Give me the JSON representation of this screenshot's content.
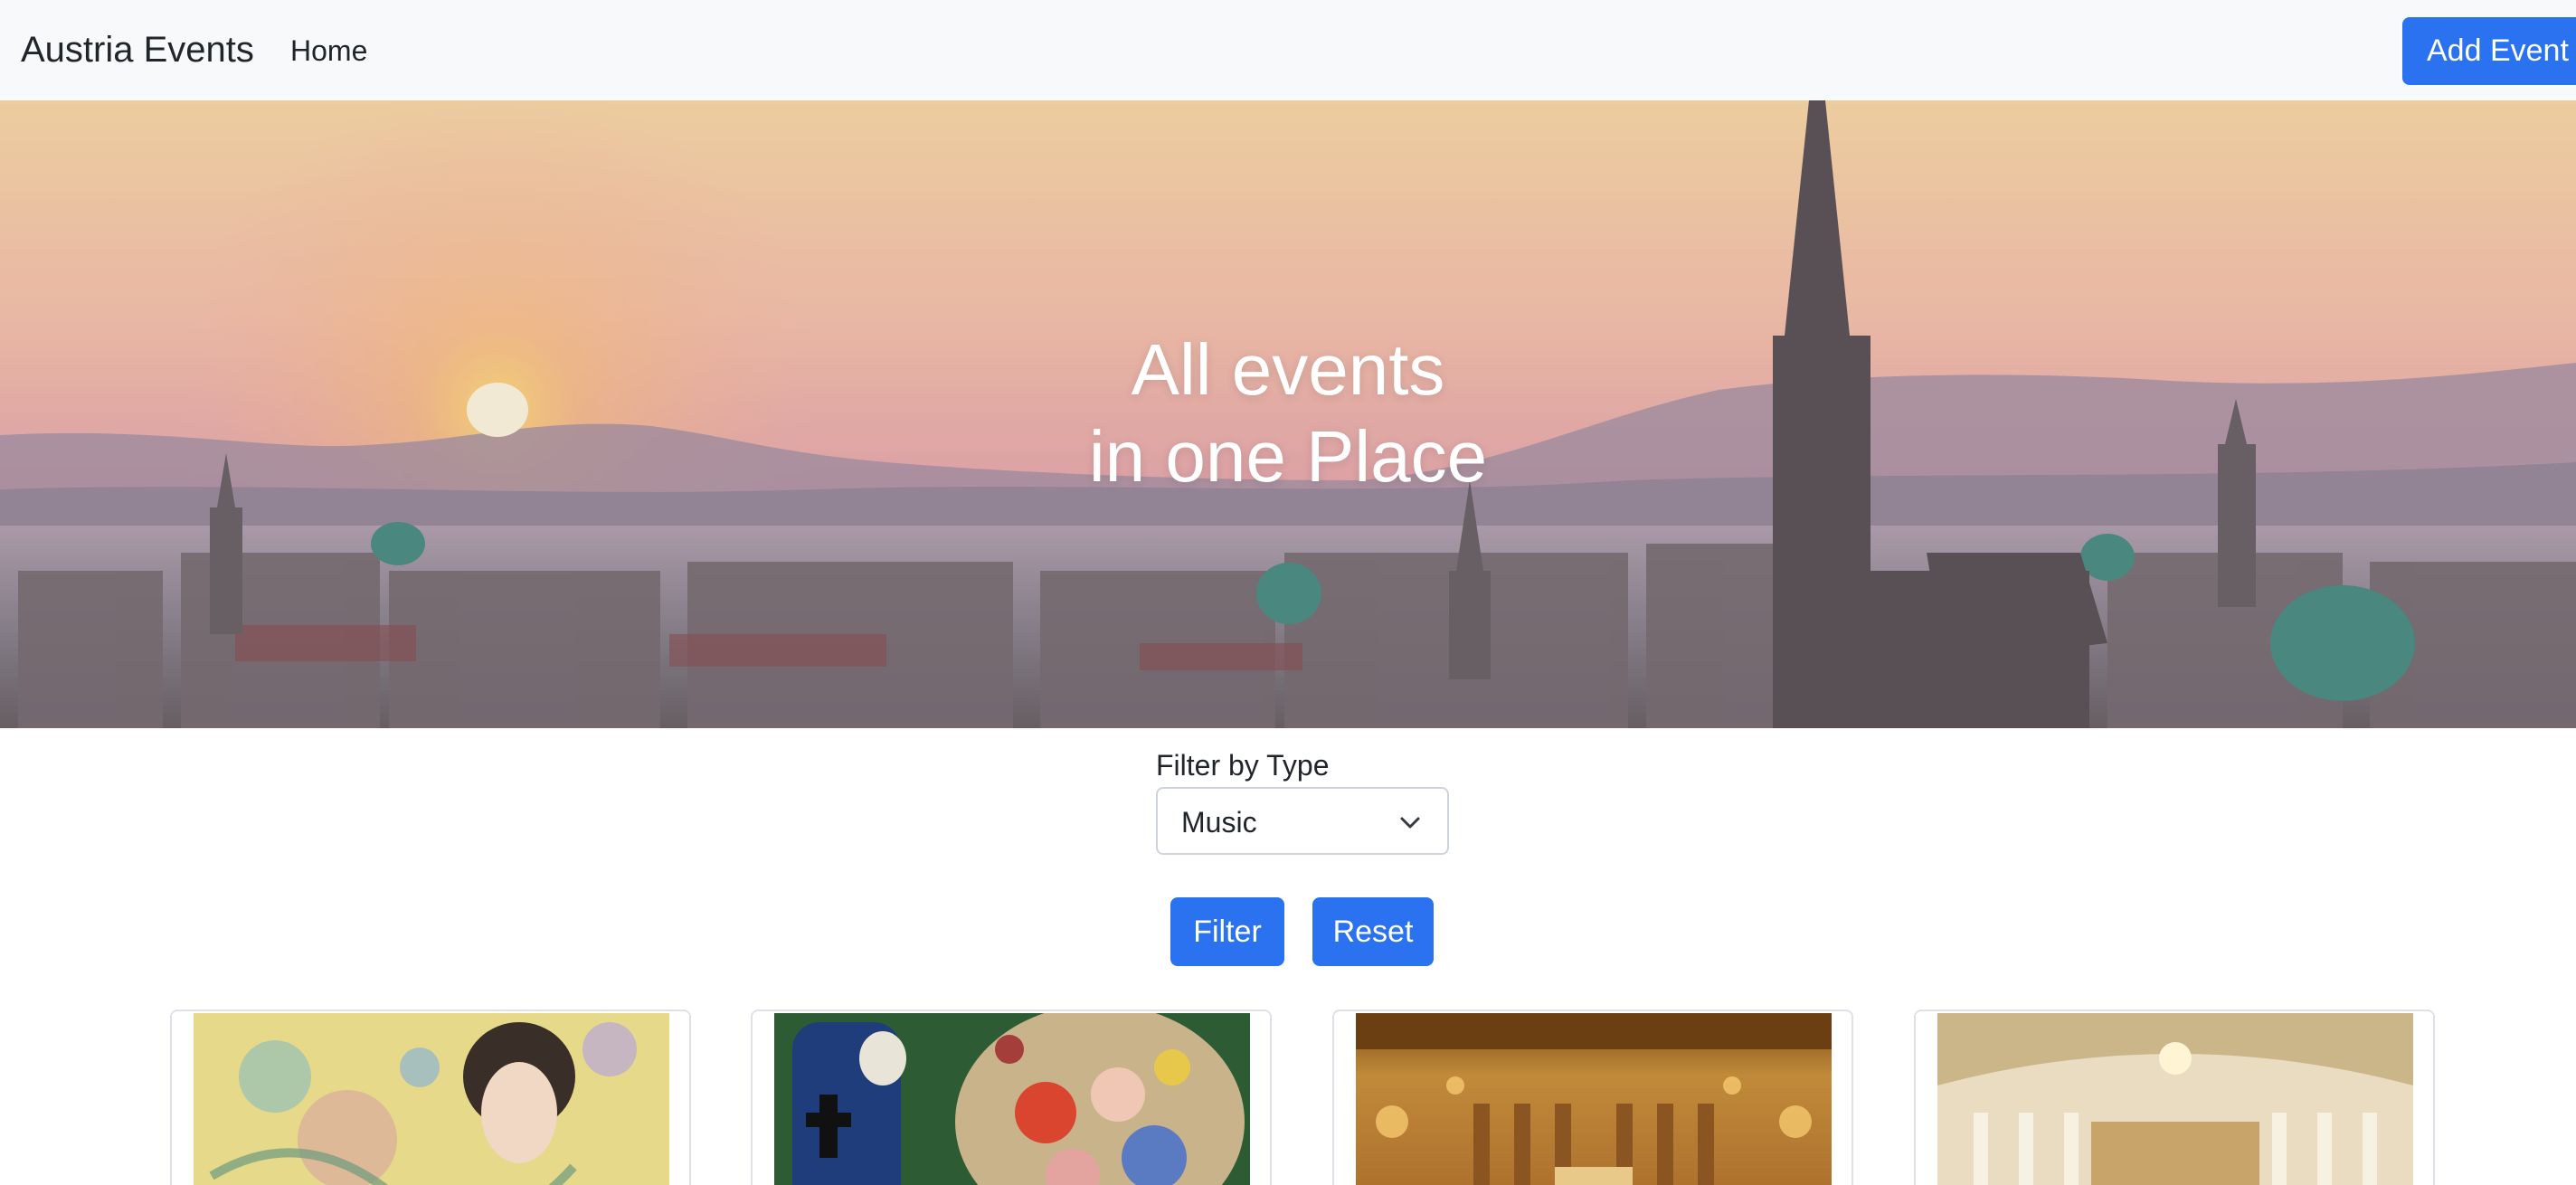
{
  "navbar": {
    "brand": "Austria Events",
    "home_link": "Home",
    "add_event_label": "Add Event"
  },
  "hero": {
    "title_line1": "All events",
    "title_line2": "in one Place",
    "background": "vienna-skyline-sunset-image"
  },
  "filter": {
    "label": "Filter by Type",
    "selected_value": "Music",
    "filter_button": "Filter",
    "reset_button": "Reset"
  },
  "cards": [
    {
      "image": "klimt-lady-with-fan-painting"
    },
    {
      "image": "klimt-death-and-life-painting"
    },
    {
      "image": "golden-concert-hall-image"
    },
    {
      "image": "white-gold-concert-hall-image"
    }
  ],
  "colors": {
    "accent": "#2b72f0",
    "navbar_bg": "#f8f9fa",
    "text": "#212529"
  }
}
